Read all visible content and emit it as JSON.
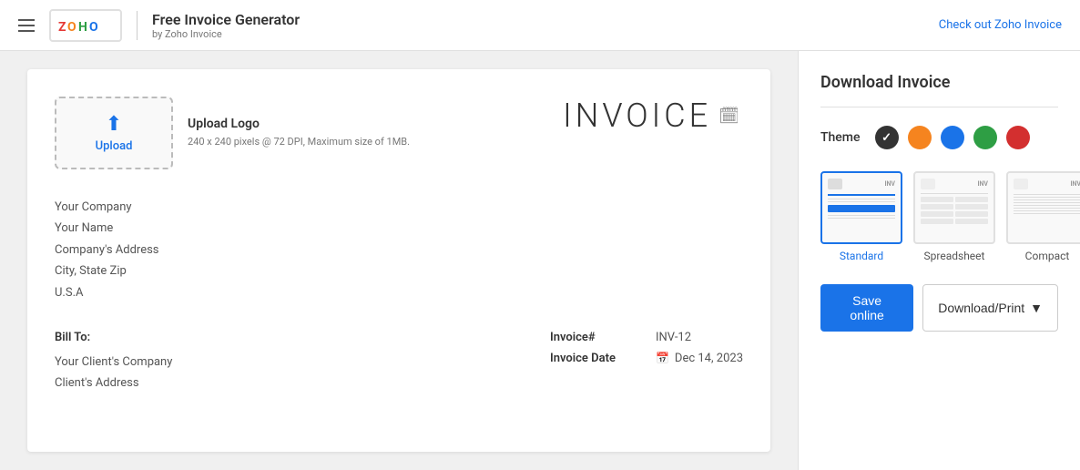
{
  "header": {
    "hamburger_label": "Menu",
    "app_title": "Free Invoice Generator",
    "app_subtitle": "by Zoho Invoice",
    "cta_link": "Check out Zoho Invoice"
  },
  "invoice": {
    "upload_title": "Upload Logo",
    "upload_hint": "240 x 240 pixels @ 72 DPI,\nMaximum size of 1MB.",
    "upload_button_label": "Upload",
    "title_text": "INVOICE",
    "company_name": "Your Company",
    "your_name": "Your Name",
    "company_address": "Company's Address",
    "city_state_zip": "City, State Zip",
    "country": "U.S.A",
    "bill_to_label": "Bill To:",
    "client_company": "Your Client's Company",
    "client_address": "Client's Address",
    "invoice_number_label": "Invoice#",
    "invoice_number_value": "INV-12",
    "invoice_date_label": "Invoice Date",
    "invoice_date_value": "Dec 14, 2023"
  },
  "panel": {
    "title": "Download Invoice",
    "theme_label": "Theme",
    "colors": [
      {
        "name": "black",
        "hex": "#333333",
        "selected": true
      },
      {
        "name": "orange",
        "hex": "#f5841f",
        "selected": false
      },
      {
        "name": "blue",
        "hex": "#1a73e8",
        "selected": false
      },
      {
        "name": "green",
        "hex": "#2e9e44",
        "selected": false
      },
      {
        "name": "red",
        "hex": "#d32f2f",
        "selected": false
      }
    ],
    "templates": [
      {
        "id": "standard",
        "label": "Standard",
        "selected": true
      },
      {
        "id": "spreadsheet",
        "label": "Spreadsheet",
        "selected": false
      },
      {
        "id": "compact",
        "label": "Compact",
        "selected": false
      }
    ],
    "save_label": "Save online",
    "download_label": "Download/Print"
  }
}
